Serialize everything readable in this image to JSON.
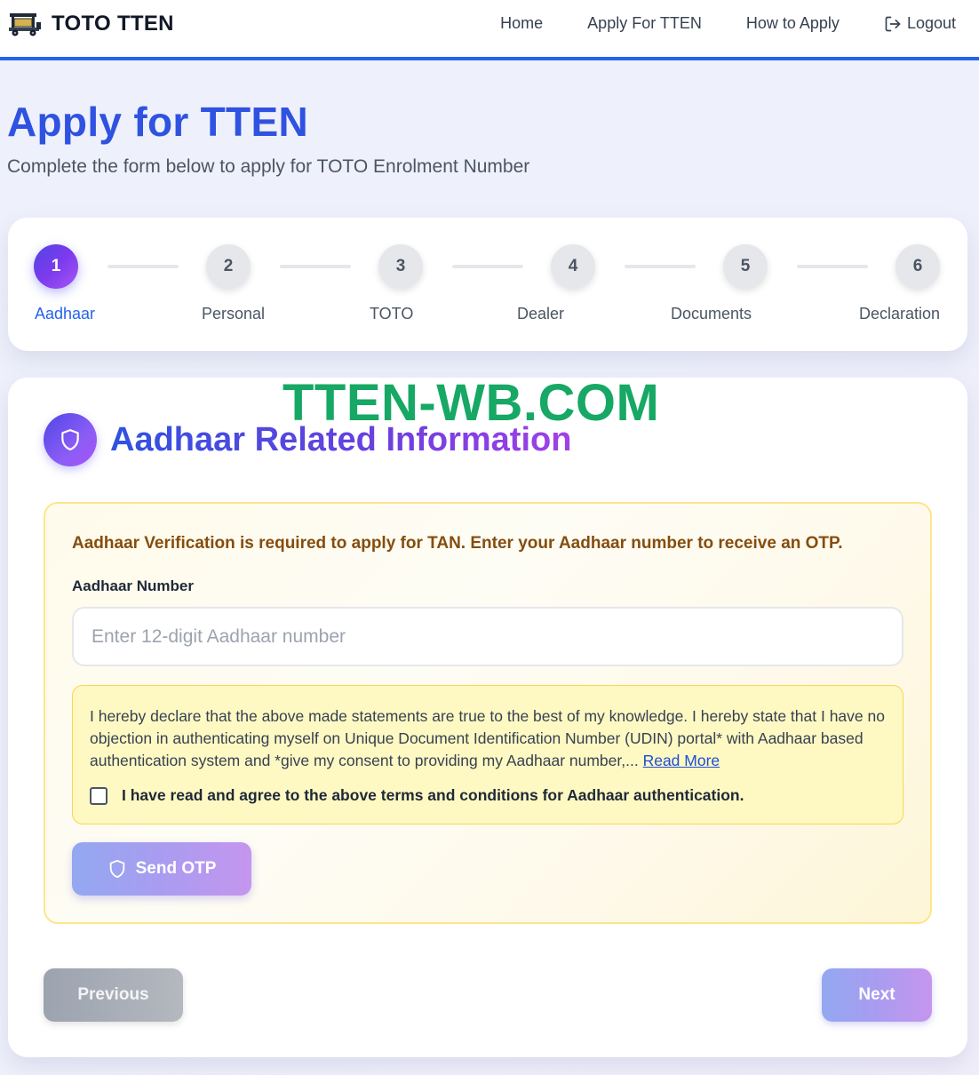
{
  "header": {
    "brand": "TOTO TTEN",
    "logo_icon": "toto-rickshaw-icon",
    "nav": [
      {
        "label": "Home"
      },
      {
        "label": "Apply For TTEN"
      },
      {
        "label": "How to Apply"
      },
      {
        "label": "Logout",
        "icon": "logout-icon"
      }
    ],
    "accent_color": "#2563eb"
  },
  "page": {
    "title": "Apply for TTEN",
    "subtitle": "Complete the form below to apply for TOTO Enrolment Number"
  },
  "stepper": {
    "current_step": 1,
    "steps": [
      {
        "number": "1",
        "label": "Aadhaar"
      },
      {
        "number": "2",
        "label": "Personal"
      },
      {
        "number": "3",
        "label": "TOTO"
      },
      {
        "number": "4",
        "label": "Dealer"
      },
      {
        "number": "5",
        "label": "Documents"
      },
      {
        "number": "6",
        "label": "Declaration"
      }
    ]
  },
  "watermark": "TTEN-WB.COM",
  "section": {
    "title": "Aadhaar Related Information",
    "icon": "shield-icon"
  },
  "verification": {
    "note": "Aadhaar Verification is required to apply for TAN. Enter your Aadhaar number to receive an OTP.",
    "field_label": "Aadhaar Number",
    "input_value": "",
    "input_placeholder": "Enter 12-digit Aadhaar number",
    "consent_text": "I hereby declare that the above made statements are true to the best of my knowledge. I hereby state that I have no objection in authenticating myself on Unique Document Identification Number (UDIN) portal* with Aadhaar based authentication system and *give my consent to providing my Aadhaar number,... ",
    "read_more": "Read More",
    "agree_label": "I have read and agree to the above terms and conditions for Aadhaar authentication.",
    "agree_checked": false,
    "send_otp_label": "Send OTP"
  },
  "footer_buttons": {
    "previous": "Previous",
    "next": "Next"
  }
}
